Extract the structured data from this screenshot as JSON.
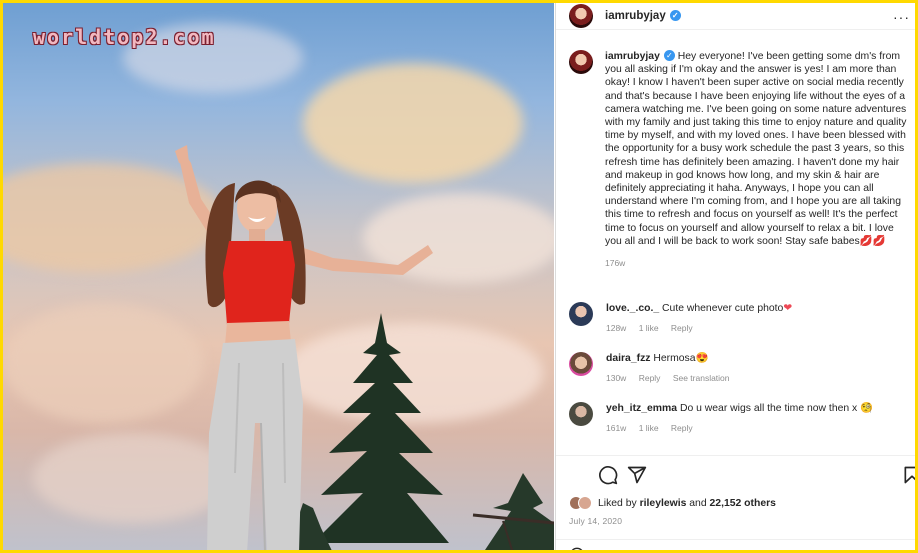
{
  "watermark": "worldtop2.com",
  "post": {
    "username": "iamrubyjay",
    "more_label": "···",
    "caption": "Hey everyone! I've been getting some dm's from you all asking if I'm okay and the answer is yes! I am more than okay! I know I haven't been super active on social media recently and that's because I have been enjoying life without the eyes of a camera watching me. I've been going on some nature adventures with my family and just taking this time to enjoy nature and quality time by myself, and with my loved ones. I have been blessed with the opportunity for a busy work schedule the past 3 years, so this refresh time has definitely been amazing. I haven't done my hair and makeup in god knows how long, and my skin & hair are definitely appreciating it haha. Anyways, I hope you can all understand where I'm coming from, and I hope you are all taking this time to refresh and focus on yourself as well! It's the perfect time to focus on yourself and allow yourself to relax a bit. I love you all and I will be back to work soon! Stay safe babes💋💋",
    "caption_time": "176w"
  },
  "comments": [
    {
      "user": "love._.co._",
      "text": "Cute whenever cute photo",
      "emoji": "❤",
      "time": "128w",
      "likes": "1 like",
      "reply": "Reply",
      "extra": ""
    },
    {
      "user": "daira_fzz",
      "text": "Hermosa",
      "emoji": "😍",
      "time": "130w",
      "likes": "",
      "reply": "Reply",
      "extra": "See translation"
    },
    {
      "user": "yeh_itz_emma",
      "text": "Do u wear wigs all the time now then x",
      "emoji": "🧐",
      "time": "161w",
      "likes": "1 like",
      "reply": "Reply",
      "extra": ""
    }
  ],
  "likes": {
    "liked_by_prefix": "Liked by ",
    "liked_by_user": "rileylewis",
    "and": " and ",
    "count": "22,152 others"
  },
  "date": "July 14, 2020",
  "colors": {
    "verified": "#3897f0",
    "heart": "#ed4956",
    "border": "#ffd900",
    "top_shirt": "#e0241c"
  },
  "icons": [
    "verified-icon",
    "comment-icon",
    "share-icon",
    "bookmark-icon",
    "emoji-icon"
  ]
}
